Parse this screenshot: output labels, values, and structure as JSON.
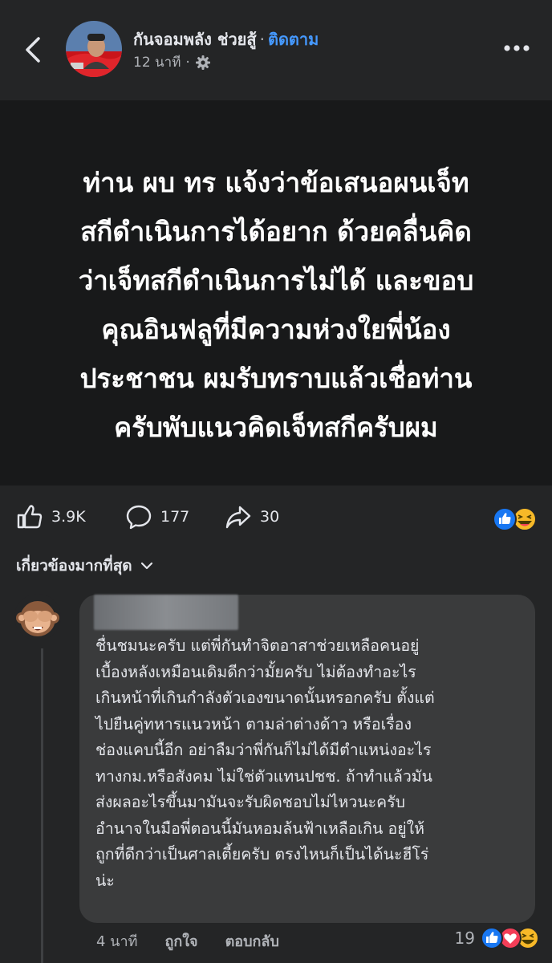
{
  "header": {
    "name": "กันจอมพลัง ช่วยสู้",
    "separator": "·",
    "follow": "ติดตาม",
    "time": "12 นาที",
    "dot": "·"
  },
  "post": {
    "lines": [
      "ท่าน ผบ ทร แจ้งว่าข้อเสนอผนเจ็ท",
      "สกีดำเนินการได้อยาก ด้วยคลื่นคิด",
      "ว่าเจ็ทสกีดำเนินการไม่ได้ และขอบ",
      "คุณอินฟลูที่มีความห่วงใยพี่น้อง",
      "ประชาชน ผมรับทราบแล้วเชื่อท่าน",
      "ครับพับแนวคิดเจ็ทสกีครับผม"
    ],
    "background": "#18191a"
  },
  "actions": {
    "likes": "3.9K",
    "comments": "177",
    "shares": "30"
  },
  "filter": {
    "label": "เกี่ยวข้องมากที่สุด"
  },
  "comment": {
    "lines": [
      "ชื่นชมนะครับ แต่พี่กันทำจิตอาสาช่วยเหลือคนอยู่",
      "เบื้องหลังเหมือนเดิมดีกว่ามั้ยครับ ไม่ต้องทำอะไร",
      "เกินหน้าที่เกินกำลังตัวเองขนาดนั้นหรอกครับ ตั้งแต่",
      "ไปยืนคู่ทหารแนวหน้า ตามล่าต่างด้าว หรือเรื่อง",
      "ช่องแคบนี้อีก อย่าลืมว่าพี่กันก็ไม่ได้มีตำแหน่งอะไร",
      "ทางกม.หรือสังคม ไม่ใช่ตัวแทนปชช. ถ้าทำแล้วมัน",
      "ส่งผลอะไรขึ้นมามันจะรับผิดชอบไม่ไหวนะครับ",
      "อำนาจในมือพี่ตอนนี้มันหอมล้นฟ้าเหลือเกิน อยู่ให้",
      "ถูกที่ดีกว่าเป็นศาลเตี้ยครับ ตรงไหนก็เป็นได้นะฮีโร่",
      "น่ะ"
    ],
    "time": "4 นาที",
    "like_label": "ถูกใจ",
    "reply_label": "ตอบกลับ",
    "reaction_count": "19"
  },
  "colors": {
    "accent": "#4599ff",
    "like_blue": "#1877f2",
    "love_red": "#f33e58",
    "haha_yellow": "#f7b928"
  },
  "icons": [
    "back-icon",
    "more-icon",
    "settings-icon",
    "like-icon",
    "comment-icon",
    "share-icon",
    "chevron-down-icon"
  ]
}
